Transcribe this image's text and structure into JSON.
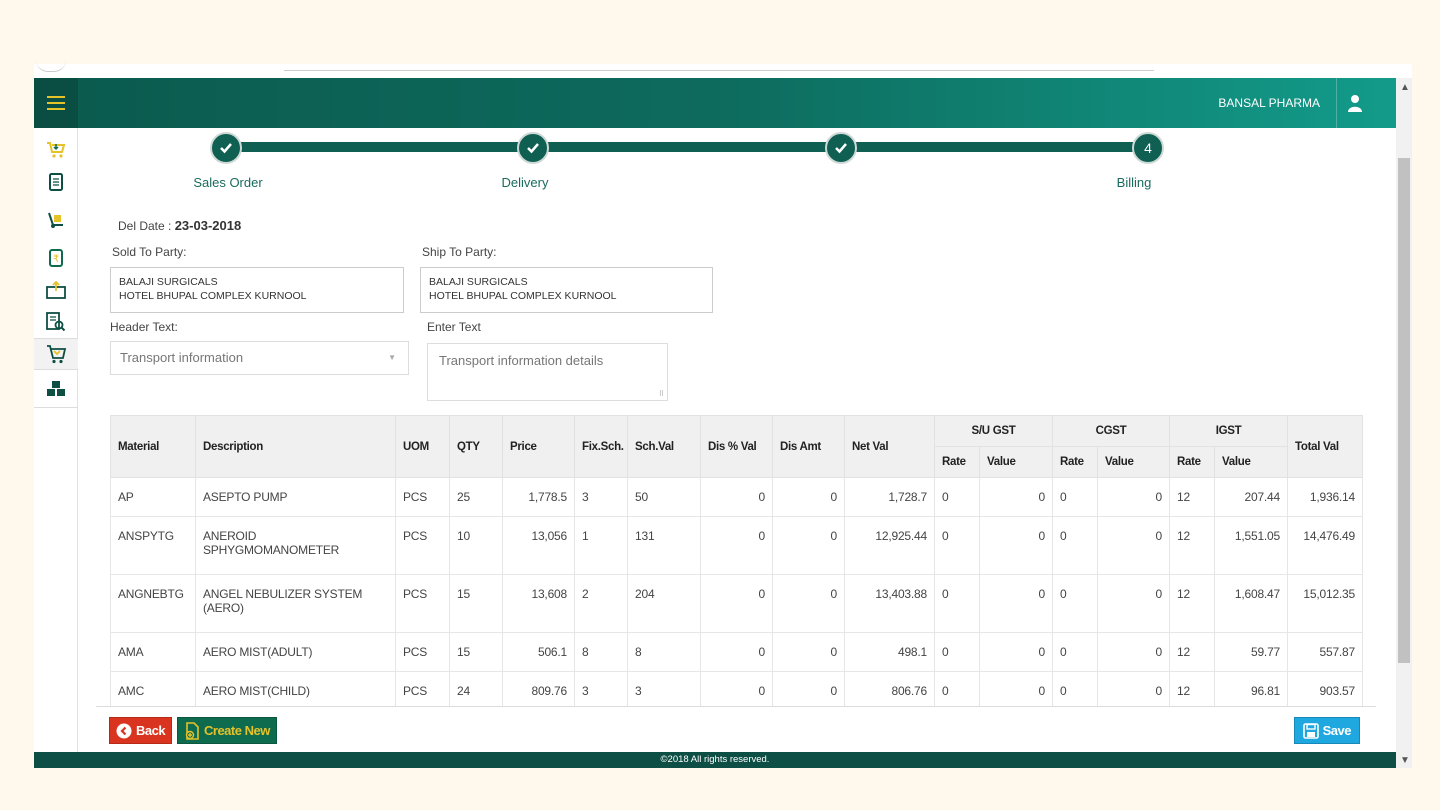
{
  "header": {
    "company": "BANSAL PHARMA"
  },
  "sidebar": {
    "items": [
      {
        "icon": "cart-icon"
      },
      {
        "icon": "document-icon"
      },
      {
        "icon": "hand-truck-icon"
      },
      {
        "icon": "rupee-document-icon"
      },
      {
        "icon": "delivery-box-icon"
      },
      {
        "icon": "report-search-icon"
      },
      {
        "icon": "basket-icon"
      },
      {
        "icon": "cubes-icon"
      }
    ]
  },
  "stepper": {
    "steps": [
      {
        "label": "Sales Order",
        "state": "done"
      },
      {
        "label": "Delivery",
        "state": "done"
      },
      {
        "label": "",
        "state": "done"
      },
      {
        "label": "Billing",
        "state": "current",
        "number": "4"
      }
    ]
  },
  "form": {
    "del_date_label": "Del Date :",
    "del_date_value": "23-03-2018",
    "sold_to_label": "Sold To Party:",
    "sold_to_line1": "BALAJI SURGICALS",
    "sold_to_line2": "HOTEL BHUPAL COMPLEX KURNOOL",
    "ship_to_label": "Ship To Party:",
    "ship_to_line1": "BALAJI SURGICALS",
    "ship_to_line2": "HOTEL BHUPAL COMPLEX KURNOOL",
    "header_text_label": "Header Text:",
    "header_text_value": "Transport information",
    "enter_text_label": "Enter Text",
    "enter_text_value": "Transport information details"
  },
  "table": {
    "headers": {
      "material": "Material",
      "description": "Description",
      "uom": "UOM",
      "qty": "QTY",
      "price": "Price",
      "fix_sch": "Fix.Sch.",
      "sch_val": "Sch.Val",
      "dis_pct_val": "Dis % Val",
      "dis_amt": "Dis Amt",
      "net_val": "Net Val",
      "su_gst": "S/U GST",
      "cgst": "CGST",
      "igst": "IGST",
      "total_val": "Total Val",
      "rate": "Rate",
      "value": "Value"
    },
    "rows": [
      {
        "material": "AP",
        "description": "ASEPTO PUMP",
        "uom": "PCS",
        "qty": "25",
        "price": "1,778.5",
        "fix_sch": "3",
        "sch_val": "50",
        "dis_pct_val": "0",
        "dis_amt": "0",
        "net_val": "1,728.7",
        "su_rate": "0",
        "su_value": "0",
        "cgst_rate": "0",
        "cgst_value": "0",
        "igst_rate": "12",
        "igst_value": "207.44",
        "total_val": "1,936.14"
      },
      {
        "material": "ANSPYTG",
        "description": "ANEROID SPHYGMOMANOMETER",
        "uom": "PCS",
        "qty": "10",
        "price": "13,056",
        "fix_sch": "1",
        "sch_val": "131",
        "dis_pct_val": "0",
        "dis_amt": "0",
        "net_val": "12,925.44",
        "su_rate": "0",
        "su_value": "0",
        "cgst_rate": "0",
        "cgst_value": "0",
        "igst_rate": "12",
        "igst_value": "1,551.05",
        "total_val": "14,476.49"
      },
      {
        "material": "ANGNEBTG",
        "description": "ANGEL NEBULIZER SYSTEM (AERO)",
        "uom": "PCS",
        "qty": "15",
        "price": "13,608",
        "fix_sch": "2",
        "sch_val": "204",
        "dis_pct_val": "0",
        "dis_amt": "0",
        "net_val": "13,403.88",
        "su_rate": "0",
        "su_value": "0",
        "cgst_rate": "0",
        "cgst_value": "0",
        "igst_rate": "12",
        "igst_value": "1,608.47",
        "total_val": "15,012.35"
      },
      {
        "material": "AMA",
        "description": "AERO MIST(ADULT)",
        "uom": "PCS",
        "qty": "15",
        "price": "506.1",
        "fix_sch": "8",
        "sch_val": "8",
        "dis_pct_val": "0",
        "dis_amt": "0",
        "net_val": "498.1",
        "su_rate": "0",
        "su_value": "0",
        "cgst_rate": "0",
        "cgst_value": "0",
        "igst_rate": "12",
        "igst_value": "59.77",
        "total_val": "557.87"
      },
      {
        "material": "AMC",
        "description": "AERO MIST(CHILD)",
        "uom": "PCS",
        "qty": "24",
        "price": "809.76",
        "fix_sch": "3",
        "sch_val": "3",
        "dis_pct_val": "0",
        "dis_amt": "0",
        "net_val": "806.76",
        "su_rate": "0",
        "su_value": "0",
        "cgst_rate": "0",
        "cgst_value": "0",
        "igst_rate": "12",
        "igst_value": "96.81",
        "total_val": "903.57"
      }
    ]
  },
  "actions": {
    "back_label": "Back",
    "create_new_label": "Create New",
    "save_label": "Save"
  },
  "footer": {
    "copyright": "©2018 All rights reserved."
  },
  "colors": {
    "header_dark": "#0b5a4e",
    "header_light": "#139b8a",
    "step": "#0f5f53",
    "back": "#d9341f",
    "create_new": "#0e6b4e",
    "save": "#1fa7e0",
    "page_bg": "#fef9ec"
  }
}
